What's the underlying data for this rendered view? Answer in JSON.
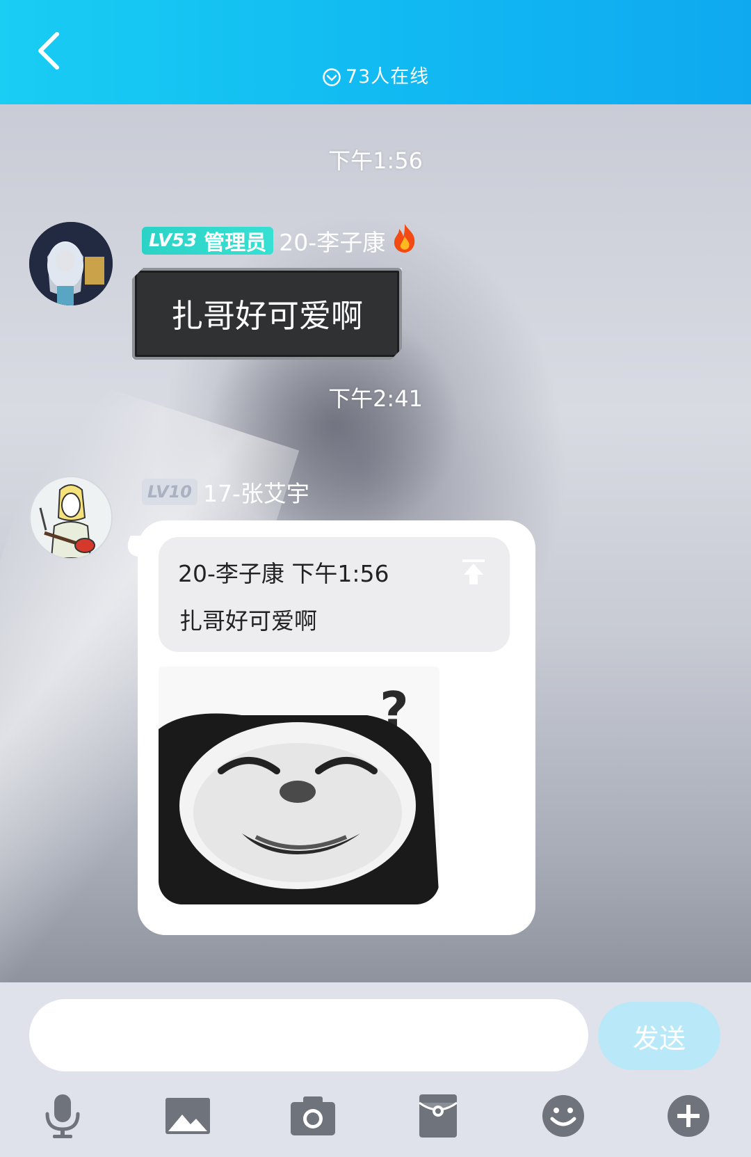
{
  "header": {
    "online_text": "73人在线"
  },
  "chat": {
    "messages": [
      {
        "timestamp": "下午1:56",
        "badge_level": "LV53",
        "badge_role": "管理员",
        "sender": "20-李子康",
        "text": "扎哥好可爱啊"
      },
      {
        "timestamp": "下午2:41",
        "badge_level": "LV10",
        "sender": "17-张艾宇",
        "quote": {
          "header": "20-李子康 下午1:56",
          "text": "扎哥好可爱啊"
        },
        "sticker_text": "?"
      }
    ]
  },
  "composer": {
    "input_value": "",
    "send_label": "发送"
  },
  "toolbar": {
    "icons": [
      "microphone-icon",
      "image-icon",
      "camera-icon",
      "red-packet-icon",
      "emoji-icon",
      "plus-icon"
    ]
  },
  "colors": {
    "header_start": "#19cdf3",
    "header_end": "#0fa9f0",
    "admin_badge": "#2bd3c6",
    "send_button": "#b9e9f8",
    "toolbar_icon": "#6f737c"
  }
}
